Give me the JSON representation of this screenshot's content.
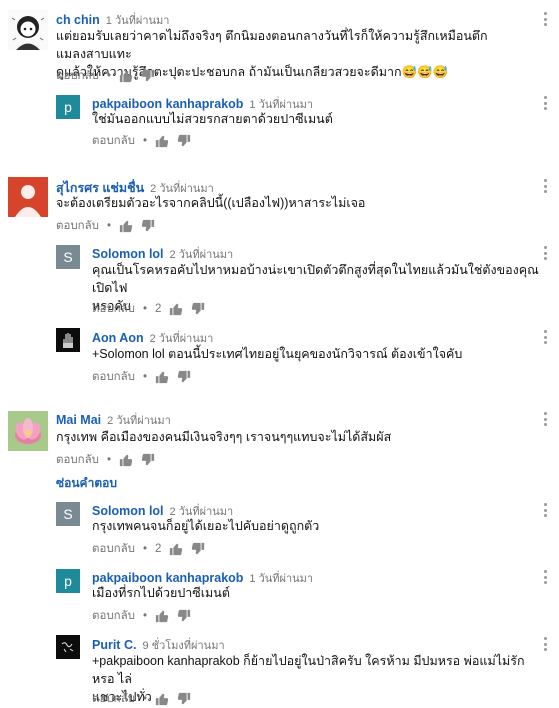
{
  "labels": {
    "reply": "ตอบกลับ",
    "dot": "•",
    "hide_replies": "ซ่อนคำตอบ"
  },
  "comments": [
    {
      "author": "ch chin",
      "time": "1 วันที่ผ่านมา",
      "text_line1": "แต่ยอมรับเลยว่าคาดไม่ถึงจริงๆ ตึกนิมองตอนกลางวันที่ไรก็ให้ความรู้สึกเหมือนตึกแมลงสาบแทะ",
      "text_line2": "ดูแล้วให้ความรู้สึกตะปุตะปะชอบกล ถ้ามันเป็นเกลียวสวยจะดีมาก😅😅😅"
    },
    {
      "author": "pakpaiboon kanhaprakob",
      "time": "1 วันที่ผ่านมา",
      "avatar_letter": "p",
      "avatar_color": "#1e8a9a",
      "text_line1": "ใช่มันออกแบบไม่สวยรกสายตาด้วยปาซีเมนต์"
    },
    {
      "author": "สุไกรศร แช่มชื่น",
      "time": "2 วันที่ผ่านมา",
      "avatar_color": "#d6452b",
      "text_line1": "จะต้องเตรียมตัวอะไรจากคลิปนี้((เปลืองไฟ))หาสาระไม่เจอ"
    },
    {
      "author": "Solomon lol",
      "time": "2 วันที่ผ่านมา",
      "avatar_letter": "S",
      "avatar_color": "#7a8a93",
      "text_line1": "คุณเป็นโรคหรอคับไปหาหมอบ้างน่ะเขาเปิดตัวตึกสูงที่สุดในไทยแล้วมันใช่ตังของคุณเปิดไฟ",
      "text_line2": "หรอคับ",
      "likes": "2"
    },
    {
      "author": "Aon Aon",
      "time": "2 วันที่ผ่านมา",
      "text_line1": "+Solomon lol ตอนนี้ประเทศไทยอยู่ในยุคของนักวิจารณ์ ต้องเข้าใจคับ"
    },
    {
      "author": "Mai Mai",
      "time": "2 วันที่ผ่านมา",
      "text_line1": "กรุงเทพ คือเมืองของคนมีเงินจริงๆๆ เราจนๆๆแทบจะไม่ได้สัมผัส"
    },
    {
      "author": "Solomon lol",
      "time": "2 วันที่ผ่านมา",
      "avatar_letter": "S",
      "avatar_color": "#7a8a93",
      "text_line1": "กรุงเทพคนจนก็อยู่ได้เยอะไปคับอย่าดูถูกตัว",
      "likes": "2"
    },
    {
      "author": "pakpaiboon kanhaprakob",
      "time": "1 วันที่ผ่านมา",
      "avatar_letter": "p",
      "avatar_color": "#1e8a9a",
      "text_line1": "เมืองที่รกไปด้วยปาซีเมนต์"
    },
    {
      "author": "Purit C.",
      "time": "9 ชั่วโมงที่ผ่านมา",
      "text_line1": "+pakpaiboon kanhaprakob ก็ย้ายไปอยู่ในป่าสิครับ ใครห้าม มีปมหรอ พ่อแม่ไม่รักหรอ ไล่",
      "text_line2": "แชวะไปทั่ว"
    }
  ]
}
